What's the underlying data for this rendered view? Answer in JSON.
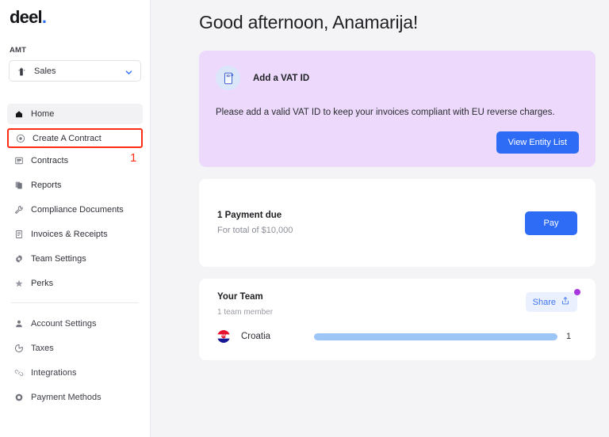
{
  "brand": {
    "logo_text": "deel",
    "logo_dot": ".",
    "accent_blue": "#2f6cf6",
    "accent_purple": "#a737e0",
    "banner_bg": "#ecd9fb",
    "annotation_red": "#ff2d16"
  },
  "sidebar": {
    "org_label": "AMT",
    "org_selected": "Sales",
    "nav_primary": [
      {
        "label": "Home",
        "icon": "home-icon",
        "state": "active"
      },
      {
        "label": "Create A Contract",
        "icon": "target-circle-icon",
        "state": "highlighted"
      },
      {
        "label": "Contracts",
        "icon": "contract-icon",
        "state": "default"
      },
      {
        "label": "Reports",
        "icon": "reports-copy-icon",
        "state": "default"
      },
      {
        "label": "Compliance Documents",
        "icon": "wrench-icon",
        "state": "default"
      },
      {
        "label": "Invoices & Receipts",
        "icon": "invoice-document-icon",
        "state": "default"
      },
      {
        "label": "Team Settings",
        "icon": "gear-icon",
        "state": "default"
      },
      {
        "label": "Perks",
        "icon": "star-icon",
        "state": "default"
      }
    ],
    "nav_secondary": [
      {
        "label": "Account Settings",
        "icon": "person-icon"
      },
      {
        "label": "Taxes",
        "icon": "pie-chart-icon"
      },
      {
        "label": "Integrations",
        "icon": "link-chain-icon"
      },
      {
        "label": "Payment Methods",
        "icon": "circle-ring-icon"
      }
    ],
    "annotation_number": "1"
  },
  "main": {
    "greeting": "Good afternoon, Anamarija!",
    "vat_banner": {
      "icon": "id-document-icon",
      "title": "Add a VAT ID",
      "message": "Please add a valid VAT ID to keep your invoices compliant with EU reverse charges.",
      "button_label": "View Entity List"
    },
    "payment_card": {
      "title": "1 Payment due",
      "subtitle": "For total of $10,000",
      "button_label": "Pay"
    },
    "team_card": {
      "title": "Your Team",
      "subtitle": "1 team member",
      "share_label": "Share",
      "share_icon": "share-upload-icon",
      "rows": [
        {
          "country": "Croatia",
          "flag": "croatia-flag-icon",
          "count": "1",
          "bar_percent": 100
        }
      ]
    }
  }
}
